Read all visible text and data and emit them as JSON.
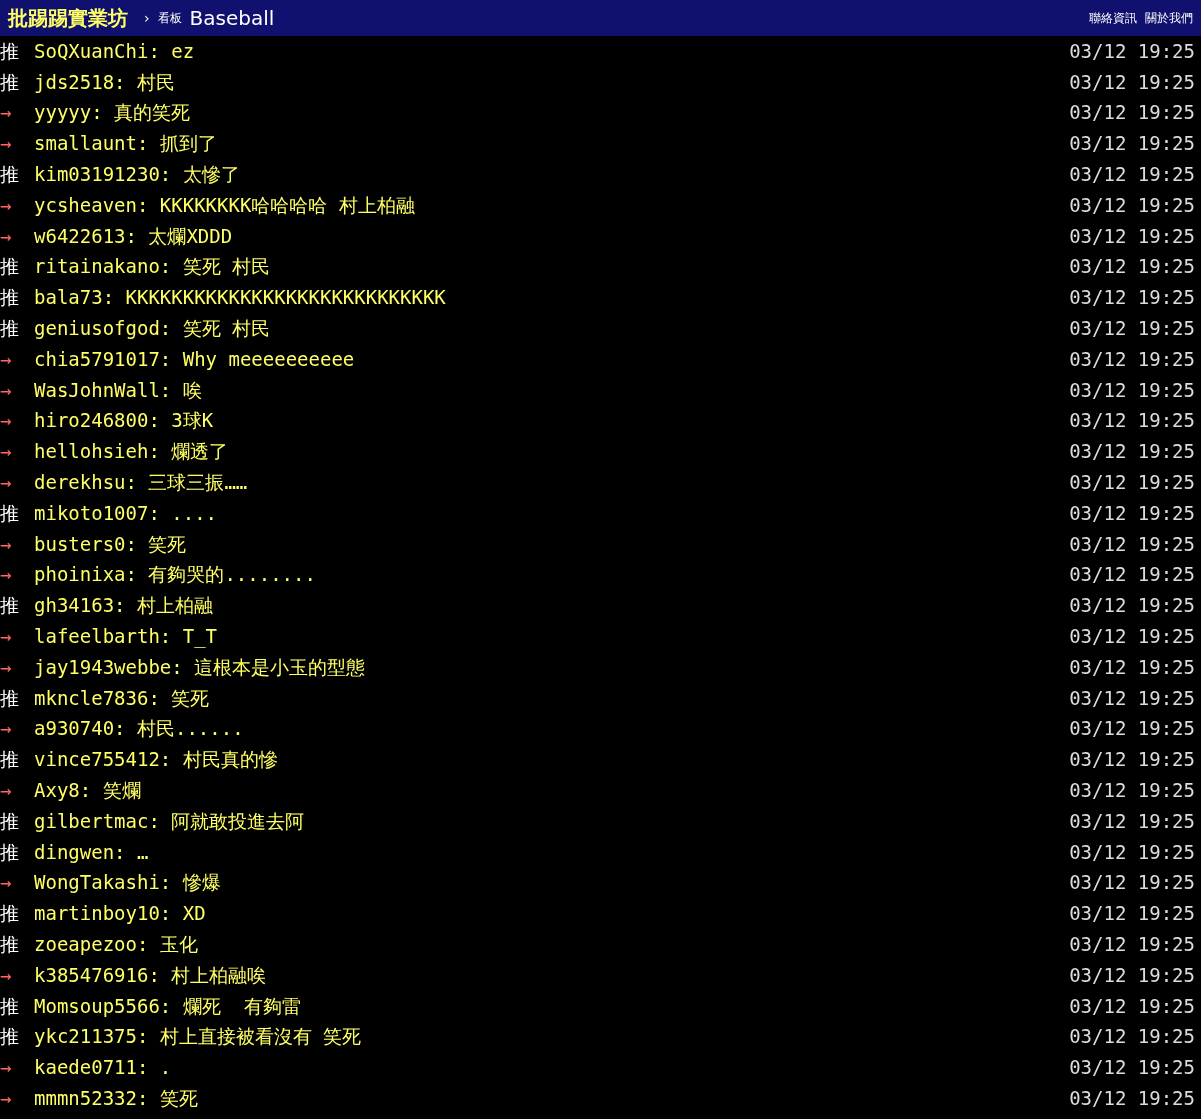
{
  "header": {
    "logo": "批踢踢實業坊",
    "separator": "›",
    "board_label": "看板",
    "board": "Baseball",
    "links": [
      "聯絡資訊",
      "關於我們"
    ]
  },
  "pushes": [
    {
      "kind": "push",
      "tag": "推",
      "user": "SoQXuanChi",
      "content": ": ez",
      "time": "03/12 19:25"
    },
    {
      "kind": "push",
      "tag": "推",
      "user": "jds2518",
      "content": ": 村民",
      "time": "03/12 19:25"
    },
    {
      "kind": "arrow",
      "tag": "→",
      "user": "yyyyy",
      "content": ": 真的笑死",
      "time": "03/12 19:25"
    },
    {
      "kind": "arrow",
      "tag": "→",
      "user": "smallaunt",
      "content": ": 抓到了",
      "time": "03/12 19:25"
    },
    {
      "kind": "push",
      "tag": "推",
      "user": "kim03191230",
      "content": ": 太慘了",
      "time": "03/12 19:25"
    },
    {
      "kind": "arrow",
      "tag": "→",
      "user": "ycsheaven",
      "content": ": KKKKKKKK哈哈哈哈 村上柏融",
      "time": "03/12 19:25"
    },
    {
      "kind": "arrow",
      "tag": "→",
      "user": "w6422613",
      "content": ": 太爛XDDD",
      "time": "03/12 19:25"
    },
    {
      "kind": "push",
      "tag": "推",
      "user": "ritainakano",
      "content": ": 笑死 村民",
      "time": "03/12 19:25"
    },
    {
      "kind": "push",
      "tag": "推",
      "user": "bala73",
      "content": ": KKKKKKKKKKKKKKKKKKKKKKKKKKKK",
      "time": "03/12 19:25"
    },
    {
      "kind": "push",
      "tag": "推",
      "user": "geniusofgod",
      "content": ": 笑死 村民",
      "time": "03/12 19:25"
    },
    {
      "kind": "arrow",
      "tag": "→",
      "user": "chia5791017",
      "content": ": Why meeeeeeeeee",
      "time": "03/12 19:25"
    },
    {
      "kind": "arrow",
      "tag": "→",
      "user": "WasJohnWall",
      "content": ": 唉",
      "time": "03/12 19:25"
    },
    {
      "kind": "arrow",
      "tag": "→",
      "user": "hiro246800",
      "content": ": 3球K",
      "time": "03/12 19:25"
    },
    {
      "kind": "arrow",
      "tag": "→",
      "user": "hellohsieh",
      "content": ": 爛透了",
      "time": "03/12 19:25"
    },
    {
      "kind": "arrow",
      "tag": "→",
      "user": "derekhsu",
      "content": ": 三球三振……",
      "time": "03/12 19:25"
    },
    {
      "kind": "push",
      "tag": "推",
      "user": "mikoto1007",
      "content": ": ....",
      "time": "03/12 19:25"
    },
    {
      "kind": "arrow",
      "tag": "→",
      "user": "busters0",
      "content": ": 笑死",
      "time": "03/12 19:25"
    },
    {
      "kind": "arrow",
      "tag": "→",
      "user": "phoinixa",
      "content": ": 有夠哭的........",
      "time": "03/12 19:25"
    },
    {
      "kind": "push",
      "tag": "推",
      "user": "gh34163",
      "content": ": 村上柏融",
      "time": "03/12 19:25"
    },
    {
      "kind": "arrow",
      "tag": "→",
      "user": "lafeelbarth",
      "content": ": T_T",
      "time": "03/12 19:25"
    },
    {
      "kind": "arrow",
      "tag": "→",
      "user": "jay1943webbe",
      "content": ": 這根本是小玉的型態",
      "time": "03/12 19:25"
    },
    {
      "kind": "push",
      "tag": "推",
      "user": "mkncle7836",
      "content": ": 笑死",
      "time": "03/12 19:25"
    },
    {
      "kind": "arrow",
      "tag": "→",
      "user": "a930740",
      "content": ": 村民......",
      "time": "03/12 19:25"
    },
    {
      "kind": "push",
      "tag": "推",
      "user": "vince755412",
      "content": ": 村民真的慘",
      "time": "03/12 19:25"
    },
    {
      "kind": "arrow",
      "tag": "→",
      "user": "Axy8",
      "content": ": 笑爛",
      "time": "03/12 19:25"
    },
    {
      "kind": "push",
      "tag": "推",
      "user": "gilbertmac",
      "content": ": 阿就敢投進去阿",
      "time": "03/12 19:25"
    },
    {
      "kind": "push",
      "tag": "推",
      "user": "dingwen",
      "content": ": …",
      "time": "03/12 19:25"
    },
    {
      "kind": "arrow",
      "tag": "→",
      "user": "WongTakashi",
      "content": ": 慘爆",
      "time": "03/12 19:25"
    },
    {
      "kind": "push",
      "tag": "推",
      "user": "martinboy10",
      "content": ": XD",
      "time": "03/12 19:25"
    },
    {
      "kind": "push",
      "tag": "推",
      "user": "zoeapezoo",
      "content": ": 玉化",
      "time": "03/12 19:25"
    },
    {
      "kind": "arrow",
      "tag": "→",
      "user": "k385476916",
      "content": ": 村上柏融唉",
      "time": "03/12 19:25"
    },
    {
      "kind": "push",
      "tag": "推",
      "user": "Momsoup5566",
      "content": ": 爛死  有夠雷",
      "time": "03/12 19:25"
    },
    {
      "kind": "push",
      "tag": "推",
      "user": "ykc211375",
      "content": ": 村上直接被看沒有 笑死",
      "time": "03/12 19:25"
    },
    {
      "kind": "arrow",
      "tag": "→",
      "user": "kaede0711",
      "content": ": .",
      "time": "03/12 19:25"
    },
    {
      "kind": "arrow",
      "tag": "→",
      "user": "mmmn52332",
      "content": ": 笑死",
      "time": "03/12 19:25"
    }
  ]
}
